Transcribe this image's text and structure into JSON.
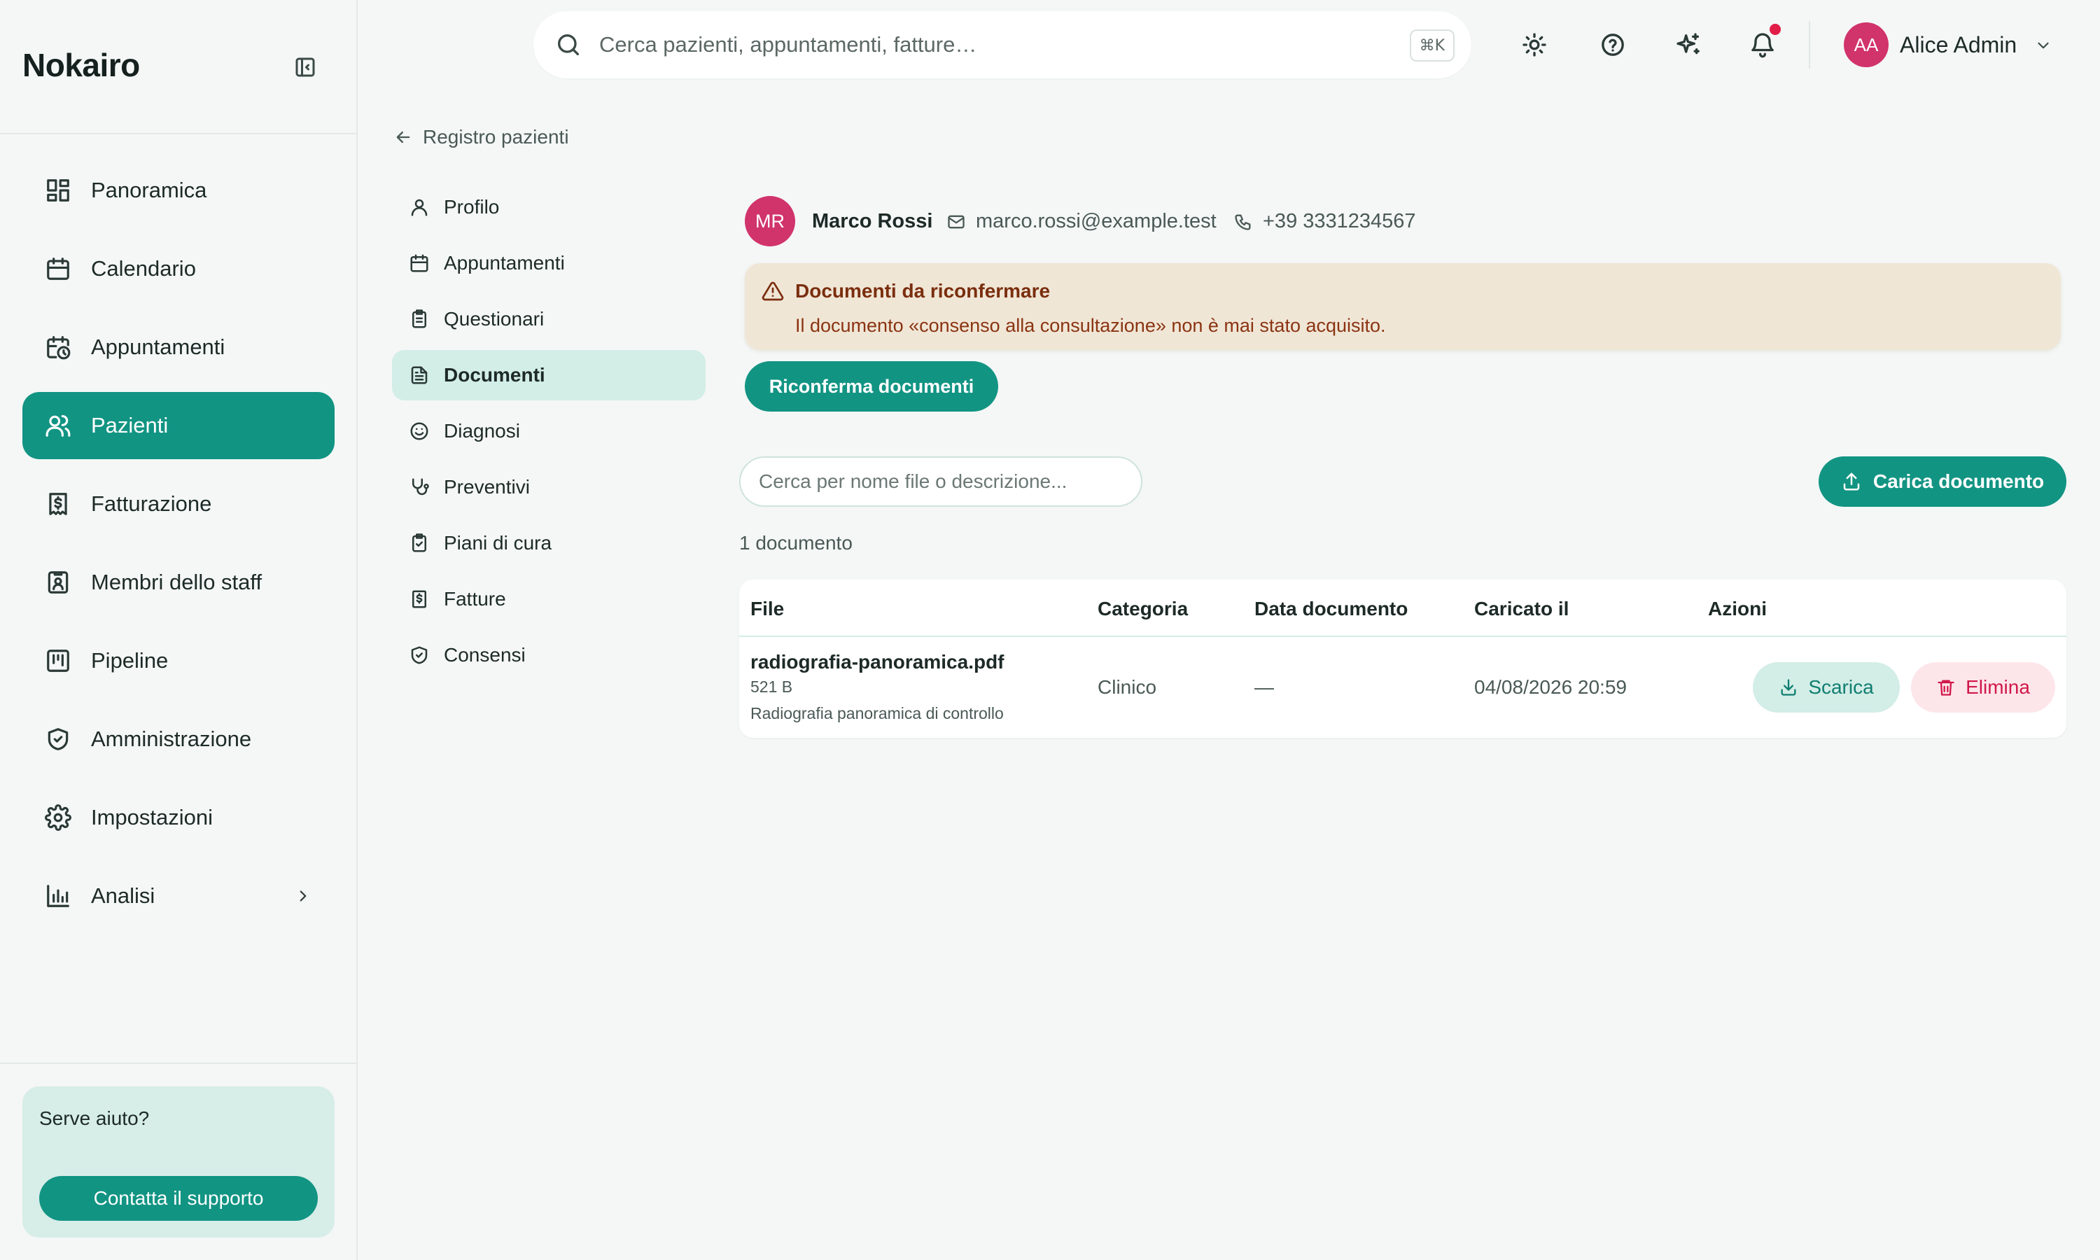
{
  "app": {
    "brand": "Nokairo"
  },
  "sidebar": {
    "items": [
      {
        "label": "Panoramica",
        "icon": "dashboard-icon"
      },
      {
        "label": "Calendario",
        "icon": "calendar-icon"
      },
      {
        "label": "Appuntamenti",
        "icon": "calendar-clock-icon"
      },
      {
        "label": "Pazienti",
        "icon": "users-icon",
        "active": true
      },
      {
        "label": "Fatturazione",
        "icon": "receipt-icon"
      },
      {
        "label": "Membri dello staff",
        "icon": "id-badge-icon"
      },
      {
        "label": "Pipeline",
        "icon": "kanban-icon"
      },
      {
        "label": "Amministrazione",
        "icon": "shield-check-icon"
      },
      {
        "label": "Impostazioni",
        "icon": "gear-icon"
      },
      {
        "label": "Analisi",
        "icon": "bar-chart-icon",
        "has_submenu": true
      }
    ],
    "help": {
      "title": "Serve aiuto?",
      "button": "Contatta il supporto"
    }
  },
  "topbar": {
    "search_placeholder": "Cerca pazienti, appuntamenti, fatture…",
    "shortcut": "⌘K",
    "user": {
      "initials": "AA",
      "name": "Alice Admin"
    }
  },
  "breadcrumb": {
    "back_label": "Registro pazienti"
  },
  "patient_nav": {
    "items": [
      {
        "label": "Profilo",
        "icon": "user-icon"
      },
      {
        "label": "Appuntamenti",
        "icon": "calendar-icon"
      },
      {
        "label": "Questionari",
        "icon": "clipboard-list-icon"
      },
      {
        "label": "Documenti",
        "icon": "file-text-icon",
        "active": true
      },
      {
        "label": "Diagnosi",
        "icon": "smile-icon"
      },
      {
        "label": "Preventivi",
        "icon": "stethoscope-icon"
      },
      {
        "label": "Piani di cura",
        "icon": "clipboard-check-icon"
      },
      {
        "label": "Fatture",
        "icon": "receipt-icon"
      },
      {
        "label": "Consensi",
        "icon": "shield-check-icon"
      }
    ]
  },
  "patient": {
    "initials": "MR",
    "name": "Marco Rossi",
    "email": "marco.rossi@example.test",
    "phone": "+39 3331234567"
  },
  "alert": {
    "title": "Documenti da riconfermare",
    "text": "Il documento «consenso alla consultazione» non è mai stato acquisito."
  },
  "actions": {
    "reconfirm": "Riconferma documenti",
    "doc_search_placeholder": "Cerca per nome file o descrizione...",
    "upload": "Carica documento"
  },
  "documents": {
    "count_label": "1 documento",
    "columns": [
      "File",
      "Categoria",
      "Data documento",
      "Caricato il",
      "Azioni"
    ],
    "rows": [
      {
        "file_name": "radiografia-panoramica.pdf",
        "size": "521 B",
        "description": "Radiografia panoramica di controllo",
        "category": "Clinico",
        "doc_date": "—",
        "uploaded_at": "04/08/2026 20:59",
        "download": "Scarica",
        "delete": "Elimina"
      }
    ]
  },
  "colors": {
    "accent": "#129483",
    "accent_soft": "#d3ede7",
    "danger": "#d0184a",
    "warning_bg": "#f0e6d6",
    "avatar": "#d1336b"
  }
}
